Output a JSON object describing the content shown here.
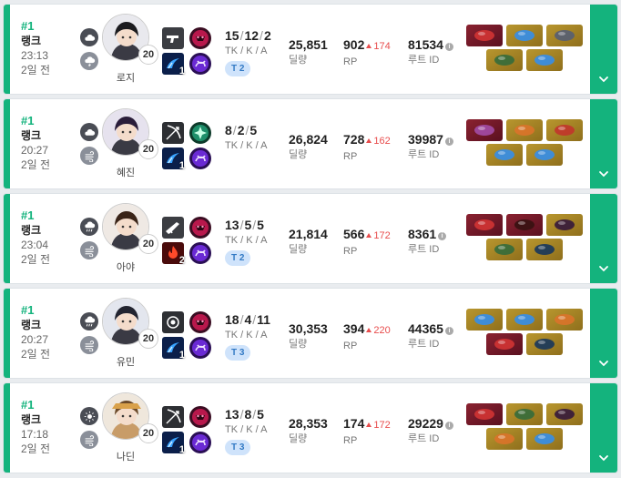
{
  "colors": {
    "accent": "#14b37d",
    "delta_up": "#e84d4d",
    "team_bg": "#cfe3fb",
    "item_legendary": "#8a2230",
    "item_epic": "#b8962e"
  },
  "labels": {
    "rank": "랭크",
    "kda": "TK / K / A",
    "damage": "딜량",
    "rp": "RP",
    "route": "루트 ID",
    "info": "i"
  },
  "games": [
    {
      "rank": "#1",
      "time": "23:13",
      "ago": "2일 전",
      "weather": [
        "cloud-icon",
        "storm-icon"
      ],
      "character": "로지",
      "level": "20",
      "skills": [
        {
          "icon": "weapon-pistol-icon",
          "badge": ""
        },
        {
          "icon": "trait-mask-icon",
          "badge": ""
        },
        {
          "icon": "tactical-blink-icon",
          "badge": "1"
        },
        {
          "icon": "trait-swirl-icon",
          "badge": ""
        }
      ],
      "kda": {
        "tk": "15",
        "k": "12",
        "a": "2"
      },
      "team": "T 2",
      "damage": "25,851",
      "rp": "902",
      "rp_delta": "174",
      "route": "81534",
      "items": [
        [
          "legendary-red",
          "epic-blue",
          "epic-gray"
        ],
        [
          "epic-green",
          "epic-blue"
        ]
      ]
    },
    {
      "rank": "#1",
      "time": "20:27",
      "ago": "2일 전",
      "weather": [
        "cloud-icon",
        "wind-icon"
      ],
      "character": "혜진",
      "level": "20",
      "skills": [
        {
          "icon": "weapon-bow-icon",
          "badge": ""
        },
        {
          "icon": "trait-star-icon",
          "badge": ""
        },
        {
          "icon": "tactical-blink-icon",
          "badge": "1"
        },
        {
          "icon": "trait-swirl-icon",
          "badge": ""
        }
      ],
      "kda": {
        "tk": "8",
        "k": "2",
        "a": "5"
      },
      "team": "",
      "damage": "26,824",
      "rp": "728",
      "rp_delta": "162",
      "route": "39987",
      "items": [
        [
          "legendary-purple",
          "epic-orange",
          "epic-mix"
        ],
        [
          "epic-blue",
          "epic-blue"
        ]
      ]
    },
    {
      "rank": "#1",
      "time": "23:04",
      "ago": "2일 전",
      "weather": [
        "rain-icon",
        "wind-icon"
      ],
      "character": "아야",
      "level": "20",
      "skills": [
        {
          "icon": "weapon-rifle-icon",
          "badge": ""
        },
        {
          "icon": "trait-mask-icon",
          "badge": ""
        },
        {
          "icon": "tactical-fire-icon",
          "badge": "2"
        },
        {
          "icon": "trait-swirl-icon",
          "badge": ""
        }
      ],
      "kda": {
        "tk": "13",
        "k": "5",
        "a": "5"
      },
      "team": "T 2",
      "damage": "21,814",
      "rp": "566",
      "rp_delta": "172",
      "route": "8361",
      "items": [
        [
          "legendary-red",
          "legendary-dark",
          "epic-hat"
        ],
        [
          "epic-green",
          "epic-boots"
        ]
      ]
    },
    {
      "rank": "#1",
      "time": "20:27",
      "ago": "2일 전",
      "weather": [
        "rain-icon",
        "wind-icon"
      ],
      "character": "유민",
      "level": "20",
      "skills": [
        {
          "icon": "weapon-glove-icon",
          "badge": ""
        },
        {
          "icon": "trait-mask-icon",
          "badge": ""
        },
        {
          "icon": "tactical-blink-icon",
          "badge": "1"
        },
        {
          "icon": "trait-swirl-icon",
          "badge": ""
        }
      ],
      "kda": {
        "tk": "18",
        "k": "4",
        "a": "11"
      },
      "team": "T 3",
      "damage": "30,353",
      "rp": "394",
      "rp_delta": "220",
      "route": "44365",
      "items": [
        [
          "epic-blue",
          "epic-blue",
          "epic-orange"
        ],
        [
          "legendary-red",
          "epic-boots"
        ]
      ]
    },
    {
      "rank": "#1",
      "time": "17:18",
      "ago": "2일 전",
      "weather": [
        "sun-icon",
        "wind-icon"
      ],
      "character": "나딘",
      "level": "20",
      "skills": [
        {
          "icon": "weapon-bow-icon",
          "badge": ""
        },
        {
          "icon": "trait-mask-icon",
          "badge": ""
        },
        {
          "icon": "tactical-blink-icon",
          "badge": "1"
        },
        {
          "icon": "trait-swirl-icon",
          "badge": ""
        }
      ],
      "kda": {
        "tk": "13",
        "k": "8",
        "a": "5"
      },
      "team": "T 3",
      "damage": "28,353",
      "rp": "174",
      "rp_delta": "172",
      "route": "29229",
      "items": [
        [
          "legendary-red",
          "epic-green",
          "epic-hat"
        ],
        [
          "epic-orange",
          "epic-blue"
        ]
      ]
    }
  ]
}
